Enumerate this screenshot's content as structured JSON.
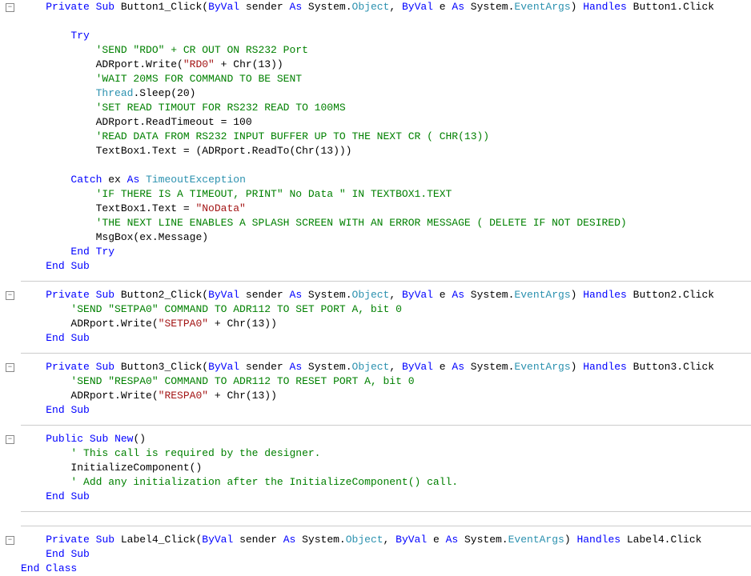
{
  "code": {
    "minus": "−",
    "lines": [
      {
        "pad": "    ",
        "tokens": [
          [
            "kw",
            "Private"
          ],
          [
            "plain",
            " "
          ],
          [
            "kw",
            "Sub"
          ],
          [
            "plain",
            " Button1_Click("
          ],
          [
            "kw",
            "ByVal"
          ],
          [
            "plain",
            " sender "
          ],
          [
            "kw",
            "As"
          ],
          [
            "plain",
            " System."
          ],
          [
            "type",
            "Object"
          ],
          [
            "plain",
            ", "
          ],
          [
            "kw",
            "ByVal"
          ],
          [
            "plain",
            " e "
          ],
          [
            "kw",
            "As"
          ],
          [
            "plain",
            " System."
          ],
          [
            "type",
            "EventArgs"
          ],
          [
            "plain",
            ") "
          ],
          [
            "kw",
            "Handles"
          ],
          [
            "plain",
            " Button1.Click"
          ]
        ]
      },
      {
        "pad": "",
        "tokens": []
      },
      {
        "pad": "        ",
        "tokens": [
          [
            "kw",
            "Try"
          ]
        ]
      },
      {
        "pad": "            ",
        "tokens": [
          [
            "cm",
            "'SEND \"RDO\" + CR OUT ON RS232 Port"
          ]
        ]
      },
      {
        "pad": "            ",
        "tokens": [
          [
            "plain",
            "ADRport.Write("
          ],
          [
            "str",
            "\"RD0\""
          ],
          [
            "plain",
            " + Chr(13))"
          ]
        ]
      },
      {
        "pad": "            ",
        "tokens": [
          [
            "cm",
            "'WAIT 20MS FOR COMMAND TO BE SENT"
          ]
        ]
      },
      {
        "pad": "            ",
        "tokens": [
          [
            "type",
            "Thread"
          ],
          [
            "plain",
            ".Sleep(20)"
          ]
        ]
      },
      {
        "pad": "            ",
        "tokens": [
          [
            "cm",
            "'SET READ TIMOUT FOR RS232 READ TO 100MS"
          ]
        ]
      },
      {
        "pad": "            ",
        "tokens": [
          [
            "plain",
            "ADRport.ReadTimeout = 100"
          ]
        ]
      },
      {
        "pad": "            ",
        "tokens": [
          [
            "cm",
            "'READ DATA FROM RS232 INPUT BUFFER UP TO THE NEXT CR ( CHR(13))"
          ]
        ]
      },
      {
        "pad": "            ",
        "tokens": [
          [
            "plain",
            "TextBox1.Text = (ADRport.ReadTo(Chr(13)))"
          ]
        ]
      },
      {
        "pad": "",
        "tokens": []
      },
      {
        "pad": "        ",
        "tokens": [
          [
            "kw",
            "Catch"
          ],
          [
            "plain",
            " ex "
          ],
          [
            "kw",
            "As"
          ],
          [
            "plain",
            " "
          ],
          [
            "type",
            "TimeoutException"
          ]
        ]
      },
      {
        "pad": "            ",
        "tokens": [
          [
            "cm",
            "'IF THERE IS A TIMEOUT, PRINT\" No Data \" IN TEXTBOX1.TEXT"
          ]
        ]
      },
      {
        "pad": "            ",
        "tokens": [
          [
            "plain",
            "TextBox1.Text = "
          ],
          [
            "str",
            "\"NoData\""
          ]
        ]
      },
      {
        "pad": "            ",
        "tokens": [
          [
            "cm",
            "'THE NEXT LINE ENABLES A SPLASH SCREEN WITH AN ERROR MESSAGE ( DELETE IF NOT DESIRED)"
          ]
        ]
      },
      {
        "pad": "            ",
        "tokens": [
          [
            "plain",
            "MsgBox(ex.Message)"
          ]
        ]
      },
      {
        "pad": "        ",
        "tokens": [
          [
            "kw",
            "End"
          ],
          [
            "plain",
            " "
          ],
          [
            "kw",
            "Try"
          ]
        ]
      },
      {
        "pad": "    ",
        "tokens": [
          [
            "kw",
            "End"
          ],
          [
            "plain",
            " "
          ],
          [
            "kw",
            "Sub"
          ]
        ]
      },
      {
        "rule": true
      },
      {
        "pad": "    ",
        "tokens": [
          [
            "kw",
            "Private"
          ],
          [
            "plain",
            " "
          ],
          [
            "kw",
            "Sub"
          ],
          [
            "plain",
            " Button2_Click("
          ],
          [
            "kw",
            "ByVal"
          ],
          [
            "plain",
            " sender "
          ],
          [
            "kw",
            "As"
          ],
          [
            "plain",
            " System."
          ],
          [
            "type",
            "Object"
          ],
          [
            "plain",
            ", "
          ],
          [
            "kw",
            "ByVal"
          ],
          [
            "plain",
            " e "
          ],
          [
            "kw",
            "As"
          ],
          [
            "plain",
            " System."
          ],
          [
            "type",
            "EventArgs"
          ],
          [
            "plain",
            ") "
          ],
          [
            "kw",
            "Handles"
          ],
          [
            "plain",
            " Button2.Click"
          ]
        ]
      },
      {
        "pad": "        ",
        "tokens": [
          [
            "cm",
            "'SEND \"SETPA0\" COMMAND TO ADR112 TO SET PORT A, bit 0"
          ]
        ]
      },
      {
        "pad": "        ",
        "tokens": [
          [
            "plain",
            "ADRport.Write("
          ],
          [
            "str",
            "\"SETPA0\""
          ],
          [
            "plain",
            " + Chr(13))"
          ]
        ]
      },
      {
        "pad": "    ",
        "tokens": [
          [
            "kw",
            "End"
          ],
          [
            "plain",
            " "
          ],
          [
            "kw",
            "Sub"
          ]
        ]
      },
      {
        "rule": true
      },
      {
        "pad": "    ",
        "tokens": [
          [
            "kw",
            "Private"
          ],
          [
            "plain",
            " "
          ],
          [
            "kw",
            "Sub"
          ],
          [
            "plain",
            " Button3_Click("
          ],
          [
            "kw",
            "ByVal"
          ],
          [
            "plain",
            " sender "
          ],
          [
            "kw",
            "As"
          ],
          [
            "plain",
            " System."
          ],
          [
            "type",
            "Object"
          ],
          [
            "plain",
            ", "
          ],
          [
            "kw",
            "ByVal"
          ],
          [
            "plain",
            " e "
          ],
          [
            "kw",
            "As"
          ],
          [
            "plain",
            " System."
          ],
          [
            "type",
            "EventArgs"
          ],
          [
            "plain",
            ") "
          ],
          [
            "kw",
            "Handles"
          ],
          [
            "plain",
            " Button3.Click"
          ]
        ]
      },
      {
        "pad": "        ",
        "tokens": [
          [
            "cm",
            "'SEND \"RESPA0\" COMMAND TO ADR112 TO RESET PORT A, bit 0"
          ]
        ]
      },
      {
        "pad": "        ",
        "tokens": [
          [
            "plain",
            "ADRport.Write("
          ],
          [
            "str",
            "\"RESPA0\""
          ],
          [
            "plain",
            " + Chr(13))"
          ]
        ]
      },
      {
        "pad": "    ",
        "tokens": [
          [
            "kw",
            "End"
          ],
          [
            "plain",
            " "
          ],
          [
            "kw",
            "Sub"
          ]
        ]
      },
      {
        "rule": true
      },
      {
        "pad": "    ",
        "tokens": [
          [
            "kw",
            "Public"
          ],
          [
            "plain",
            " "
          ],
          [
            "kw",
            "Sub"
          ],
          [
            "plain",
            " "
          ],
          [
            "kw",
            "New"
          ],
          [
            "plain",
            "()"
          ]
        ]
      },
      {
        "pad": "        ",
        "tokens": [
          [
            "cm",
            "' This call is required by the designer."
          ]
        ]
      },
      {
        "pad": "        ",
        "tokens": [
          [
            "plain",
            "InitializeComponent()"
          ]
        ]
      },
      {
        "pad": "        ",
        "tokens": [
          [
            "cm",
            "' Add any initialization after the InitializeComponent() call."
          ]
        ]
      },
      {
        "pad": "    ",
        "tokens": [
          [
            "kw",
            "End"
          ],
          [
            "plain",
            " "
          ],
          [
            "kw",
            "Sub"
          ]
        ]
      },
      {
        "rule": true
      },
      {
        "rule": true
      },
      {
        "pad": "    ",
        "tokens": [
          [
            "kw",
            "Private"
          ],
          [
            "plain",
            " "
          ],
          [
            "kw",
            "Sub"
          ],
          [
            "plain",
            " Label4_Click("
          ],
          [
            "kw",
            "ByVal"
          ],
          [
            "plain",
            " sender "
          ],
          [
            "kw",
            "As"
          ],
          [
            "plain",
            " System."
          ],
          [
            "type",
            "Object"
          ],
          [
            "plain",
            ", "
          ],
          [
            "kw",
            "ByVal"
          ],
          [
            "plain",
            " e "
          ],
          [
            "kw",
            "As"
          ],
          [
            "plain",
            " System."
          ],
          [
            "type",
            "EventArgs"
          ],
          [
            "plain",
            ") "
          ],
          [
            "kw",
            "Handles"
          ],
          [
            "plain",
            " Label4.Click"
          ]
        ]
      },
      {
        "pad": "    ",
        "tokens": [
          [
            "kw",
            "End"
          ],
          [
            "plain",
            " "
          ],
          [
            "kw",
            "Sub"
          ]
        ]
      },
      {
        "pad": "",
        "tokens": [
          [
            "kw",
            "End"
          ],
          [
            "plain",
            " "
          ],
          [
            "kw",
            "Class"
          ]
        ]
      }
    ],
    "fold_rows": [
      0,
      20,
      25,
      30,
      37
    ]
  }
}
